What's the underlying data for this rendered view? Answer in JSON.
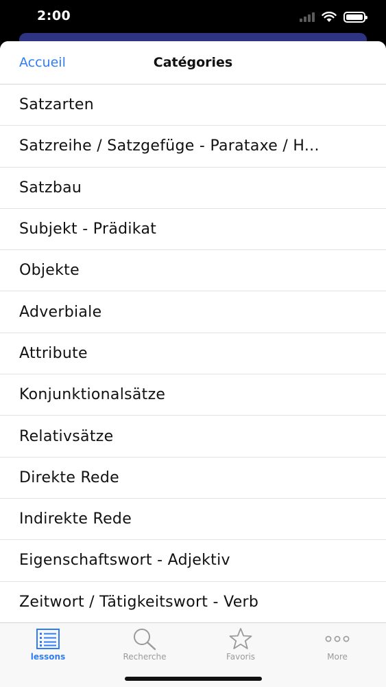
{
  "status_bar": {
    "time": "2:00"
  },
  "nav": {
    "back_label": "Accueil",
    "title": "Catégories"
  },
  "categories": [
    {
      "label": "Satzarten"
    },
    {
      "label": "Satzreihe / Satzgefüge - Parataxe / H..."
    },
    {
      "label": "Satzbau"
    },
    {
      "label": "Subjekt - Prädikat"
    },
    {
      "label": "Objekte"
    },
    {
      "label": "Adverbiale"
    },
    {
      "label": "Attribute"
    },
    {
      "label": "Konjunktionalsätze"
    },
    {
      "label": "Relativsätze"
    },
    {
      "label": "Direkte Rede"
    },
    {
      "label": "Indirekte Rede"
    },
    {
      "label": "Eigenschaftswort - Adjektiv"
    },
    {
      "label": "Zeitwort / Tätigkeitswort - Verb"
    }
  ],
  "tabs": [
    {
      "label": "lessons",
      "icon": "list-icon",
      "active": true
    },
    {
      "label": "Recherche",
      "icon": "search-icon",
      "active": false
    },
    {
      "label": "Favoris",
      "icon": "star-icon",
      "active": false
    },
    {
      "label": "More",
      "icon": "more-icon",
      "active": false
    }
  ],
  "colors": {
    "accent": "#2f7cf6",
    "header_card": "#2e3482",
    "inactive": "#9a9a9a"
  }
}
